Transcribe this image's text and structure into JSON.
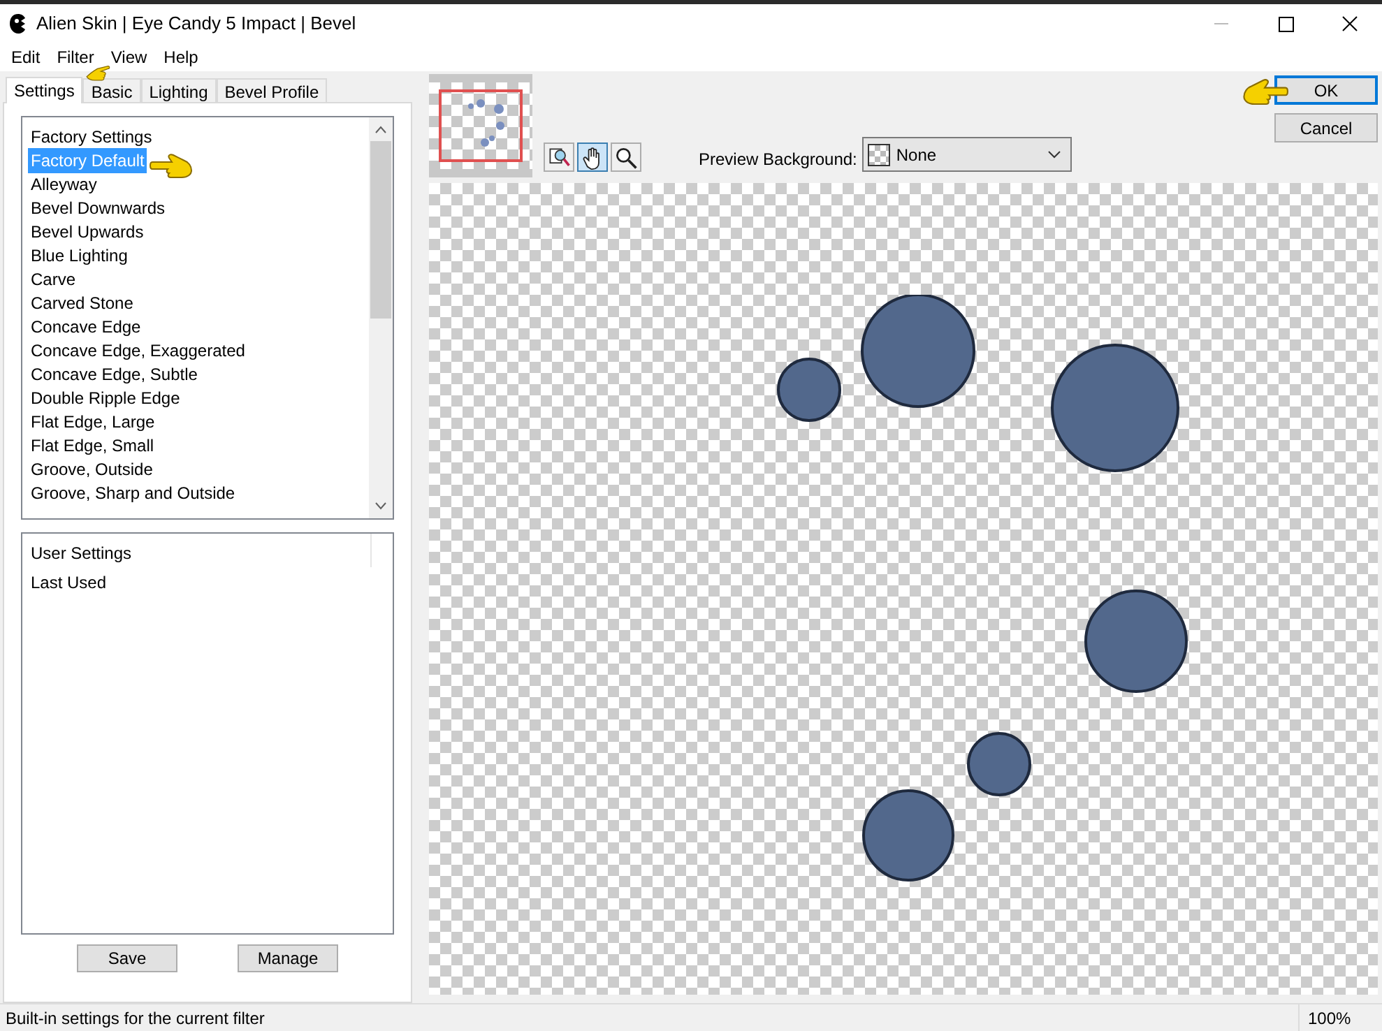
{
  "window": {
    "title": "Alien Skin | Eye Candy 5 Impact | Bevel"
  },
  "menu": [
    "Edit",
    "Filter",
    "View",
    "Help"
  ],
  "tabs": [
    {
      "label": "Settings",
      "selected": true
    },
    {
      "label": "Basic",
      "selected": false
    },
    {
      "label": "Lighting",
      "selected": false
    },
    {
      "label": "Bevel Profile",
      "selected": false
    }
  ],
  "factory_settings": {
    "header": "Factory Settings",
    "items": [
      {
        "label": "Factory Default",
        "selected": true
      },
      {
        "label": "Alleyway",
        "selected": false
      },
      {
        "label": "Bevel Downwards",
        "selected": false
      },
      {
        "label": "Bevel Upwards",
        "selected": false
      },
      {
        "label": "Blue Lighting",
        "selected": false
      },
      {
        "label": "Carve",
        "selected": false
      },
      {
        "label": "Carved Stone",
        "selected": false
      },
      {
        "label": "Concave Edge",
        "selected": false
      },
      {
        "label": "Concave Edge, Exaggerated",
        "selected": false
      },
      {
        "label": "Concave Edge, Subtle",
        "selected": false
      },
      {
        "label": "Double Ripple Edge",
        "selected": false
      },
      {
        "label": "Flat Edge, Large",
        "selected": false
      },
      {
        "label": "Flat Edge, Small",
        "selected": false
      },
      {
        "label": "Groove, Outside",
        "selected": false
      },
      {
        "label": "Groove, Sharp and Outside",
        "selected": false
      }
    ]
  },
  "user_settings": {
    "header": "User Settings",
    "items": [
      {
        "label": "Last Used",
        "selected": false
      }
    ]
  },
  "settings_buttons": [
    "Save",
    "Manage"
  ],
  "preview_tools": [
    {
      "kind": "navigate",
      "selected": false
    },
    {
      "kind": "hand",
      "selected": true
    },
    {
      "kind": "zoom",
      "selected": false
    }
  ],
  "preview_background": {
    "label": "Preview Background:",
    "value": "None"
  },
  "dialog_buttons": [
    {
      "label": "OK",
      "default": true
    },
    {
      "label": "Cancel",
      "default": false
    }
  ],
  "status_bar": {
    "text": "Built-in settings for the current filter",
    "zoom": "100%"
  }
}
